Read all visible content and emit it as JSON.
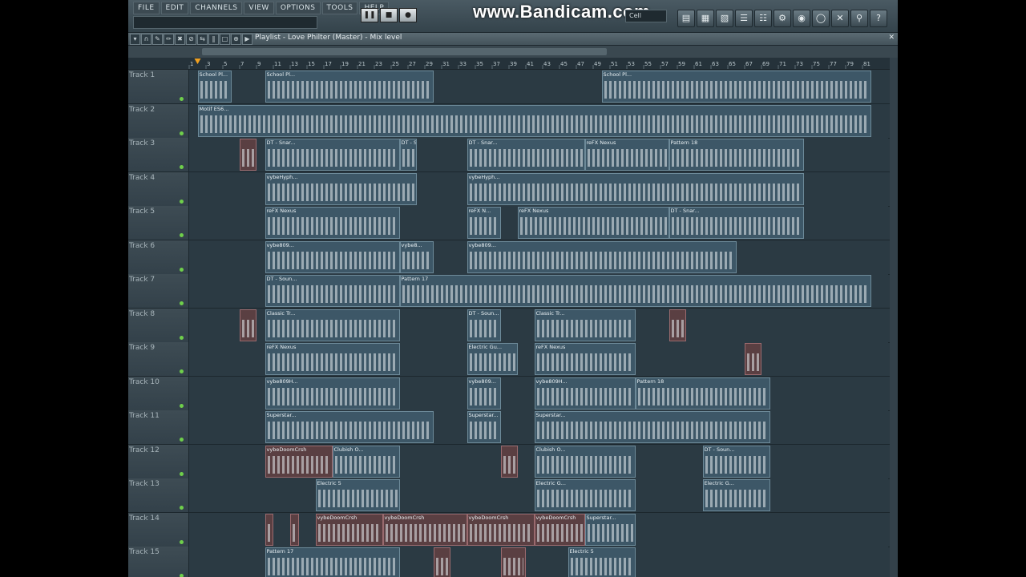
{
  "watermark": "www.Bandicam.com",
  "menu": [
    "FILE",
    "EDIT",
    "CHANNELS",
    "VIEW",
    "OPTIONS",
    "TOOLS",
    "HELP"
  ],
  "snap": "Cell",
  "playlist_title": "Playlist - Love Philter (Master) - Mix level",
  "ruler_numbers": [
    1,
    3,
    5,
    7,
    9,
    11,
    13,
    15,
    17,
    19,
    21,
    23,
    25,
    27,
    29,
    31,
    33,
    35,
    37,
    39,
    41,
    43,
    45,
    47,
    49,
    51,
    53,
    55,
    57,
    59,
    61,
    63,
    65,
    67,
    69,
    71,
    73,
    75,
    77,
    79,
    81
  ],
  "tracks": [
    {
      "name": "Track 1",
      "clips": [
        {
          "start": 2,
          "end": 6,
          "label": "School Pl..."
        },
        {
          "start": 10,
          "end": 30,
          "label": "School Pl..."
        },
        {
          "start": 50,
          "end": 82,
          "label": "School Pl..."
        }
      ]
    },
    {
      "name": "Track 2",
      "clips": [
        {
          "start": 2,
          "end": 82,
          "label": "Motif ES6..."
        }
      ]
    },
    {
      "name": "Track 3",
      "clips": [
        {
          "start": 7,
          "end": 9,
          "label": ""
        },
        {
          "start": 10,
          "end": 26,
          "label": "DT - Snar..."
        },
        {
          "start": 26,
          "end": 28,
          "label": "DT - S..."
        },
        {
          "start": 34,
          "end": 48,
          "label": "DT - Snar..."
        },
        {
          "start": 48,
          "end": 58,
          "label": "reFX Nexus"
        },
        {
          "start": 58,
          "end": 74,
          "label": "Pattern 18"
        }
      ]
    },
    {
      "name": "Track 4",
      "clips": [
        {
          "start": 10,
          "end": 28,
          "label": "vybeHyph..."
        },
        {
          "start": 34,
          "end": 74,
          "label": "vybeHyph..."
        }
      ]
    },
    {
      "name": "Track 5",
      "clips": [
        {
          "start": 10,
          "end": 26,
          "label": "reFX Nexus"
        },
        {
          "start": 34,
          "end": 38,
          "label": "reFX N..."
        },
        {
          "start": 40,
          "end": 58,
          "label": "reFX Nexus"
        },
        {
          "start": 58,
          "end": 74,
          "label": "DT - Snar..."
        }
      ]
    },
    {
      "name": "Track 6",
      "clips": [
        {
          "start": 10,
          "end": 26,
          "label": "vybe809..."
        },
        {
          "start": 26,
          "end": 30,
          "label": "vybe8..."
        },
        {
          "start": 34,
          "end": 66,
          "label": "vybe809..."
        }
      ]
    },
    {
      "name": "Track 7",
      "clips": [
        {
          "start": 10,
          "end": 26,
          "label": "DT - Soun..."
        },
        {
          "start": 26,
          "end": 82,
          "label": "Pattern 17"
        }
      ]
    },
    {
      "name": "Track 8",
      "clips": [
        {
          "start": 7,
          "end": 9,
          "label": ""
        },
        {
          "start": 10,
          "end": 26,
          "label": "Classic Tr..."
        },
        {
          "start": 34,
          "end": 38,
          "label": "DT - Soun..."
        },
        {
          "start": 42,
          "end": 54,
          "label": "Classic Tr..."
        },
        {
          "start": 58,
          "end": 60,
          "label": ""
        }
      ]
    },
    {
      "name": "Track 9",
      "clips": [
        {
          "start": 10,
          "end": 26,
          "label": "reFX Nexus"
        },
        {
          "start": 34,
          "end": 40,
          "label": "Electric Gu..."
        },
        {
          "start": 42,
          "end": 54,
          "label": "reFX Nexus"
        },
        {
          "start": 67,
          "end": 69,
          "label": ""
        }
      ]
    },
    {
      "name": "Track 10",
      "clips": [
        {
          "start": 10,
          "end": 26,
          "label": "vybe809H..."
        },
        {
          "start": 34,
          "end": 38,
          "label": "vybe809..."
        },
        {
          "start": 42,
          "end": 54,
          "label": "vybe809H..."
        },
        {
          "start": 54,
          "end": 70,
          "label": "Pattern 18"
        }
      ]
    },
    {
      "name": "Track 11",
      "clips": [
        {
          "start": 10,
          "end": 30,
          "label": "Superstar..."
        },
        {
          "start": 34,
          "end": 38,
          "label": "Superstar..."
        },
        {
          "start": 42,
          "end": 70,
          "label": "Superstar..."
        }
      ]
    },
    {
      "name": "Track 12",
      "clips": [
        {
          "start": 10,
          "end": 18,
          "label": "vybeDoomCrsh"
        },
        {
          "start": 18,
          "end": 26,
          "label": "Clubish O..."
        },
        {
          "start": 38,
          "end": 40,
          "label": ""
        },
        {
          "start": 42,
          "end": 54,
          "label": "Clubish O..."
        },
        {
          "start": 62,
          "end": 70,
          "label": "DT - Soun..."
        }
      ]
    },
    {
      "name": "Track 13",
      "clips": [
        {
          "start": 16,
          "end": 26,
          "label": "Electric 5"
        },
        {
          "start": 42,
          "end": 54,
          "label": "Electric G..."
        },
        {
          "start": 62,
          "end": 70,
          "label": "Electric G..."
        }
      ]
    },
    {
      "name": "Track 14",
      "clips": [
        {
          "start": 10,
          "end": 11,
          "label": ""
        },
        {
          "start": 13,
          "end": 14,
          "label": ""
        },
        {
          "start": 16,
          "end": 24,
          "label": "vybeDoomCrsh"
        },
        {
          "start": 24,
          "end": 34,
          "label": "vybeDoomCrsh"
        },
        {
          "start": 34,
          "end": 42,
          "label": "vybeDoomCrsh"
        },
        {
          "start": 42,
          "end": 48,
          "label": "vybeDoomCrsh"
        },
        {
          "start": 48,
          "end": 54,
          "label": "Superstar..."
        }
      ]
    },
    {
      "name": "Track 15",
      "clips": [
        {
          "start": 10,
          "end": 26,
          "label": "Pattern 17"
        },
        {
          "start": 30,
          "end": 32,
          "label": ""
        },
        {
          "start": 38,
          "end": 41,
          "label": ""
        },
        {
          "start": 46,
          "end": 54,
          "label": "Electric 5"
        }
      ]
    }
  ]
}
